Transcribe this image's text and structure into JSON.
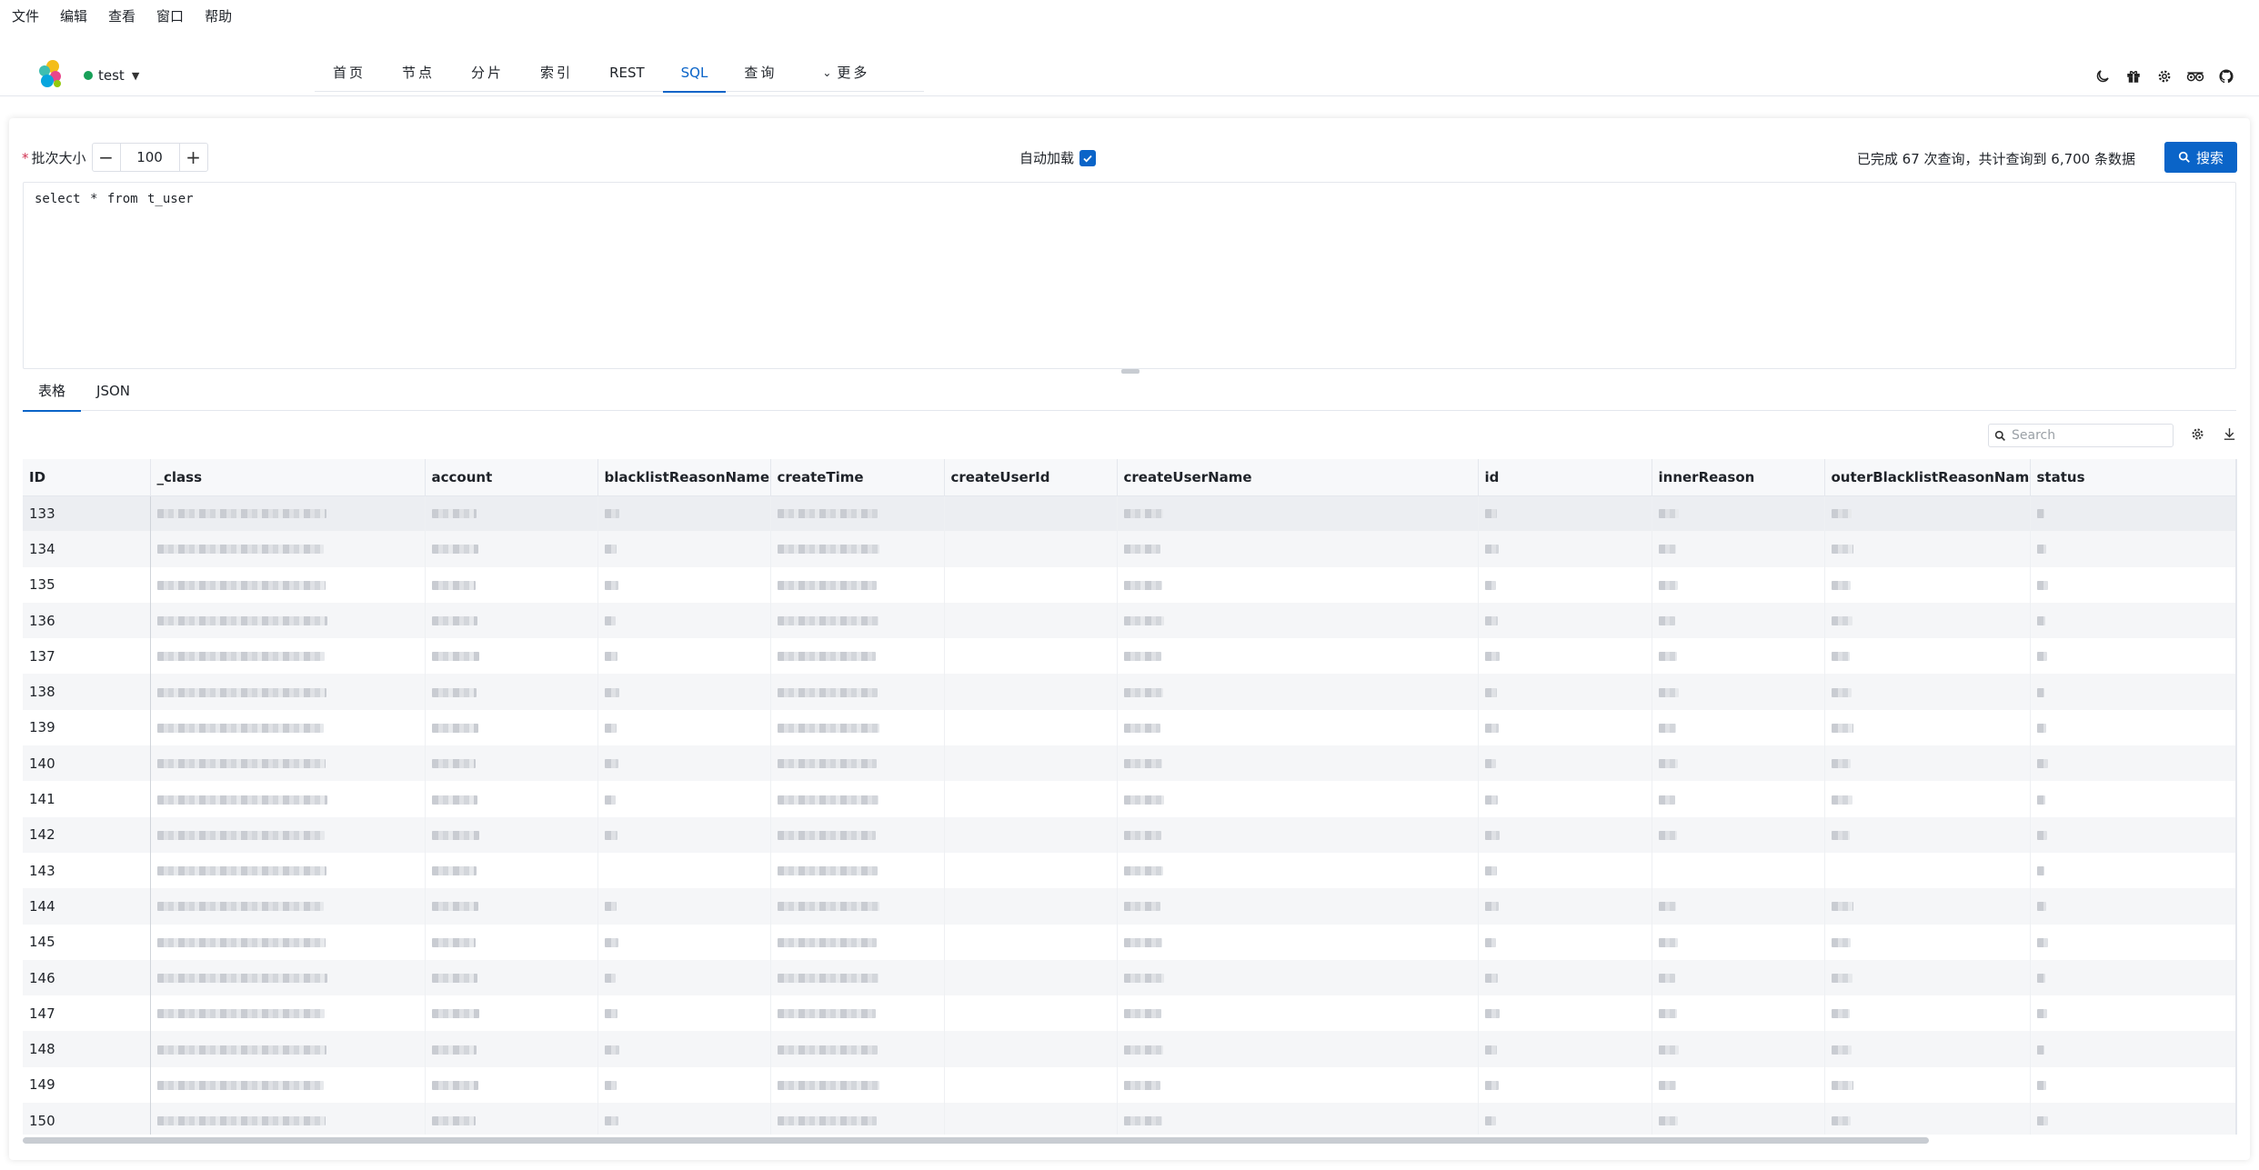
{
  "menubar": [
    "文件",
    "编辑",
    "查看",
    "窗口",
    "帮助"
  ],
  "cluster": {
    "name": "test",
    "status_color": "#18a058"
  },
  "nav": [
    {
      "label": "首页",
      "active": false
    },
    {
      "label": "节点",
      "active": false
    },
    {
      "label": "分片",
      "active": false
    },
    {
      "label": "索引",
      "active": false
    },
    {
      "label": "REST",
      "active": false
    },
    {
      "label": "SQL",
      "active": true
    },
    {
      "label": "查询",
      "active": false
    },
    {
      "label": "更多",
      "active": false
    }
  ],
  "header_icons": [
    "moon-icon",
    "gift-icon",
    "settings-icon",
    "tripadvisor-icon",
    "github-icon"
  ],
  "toolbar": {
    "batch_label": "批次大小",
    "batch_value": "100",
    "autoload_label": "自动加载",
    "autoload_checked": true,
    "status": "已完成 67 次查询，共计查询到 6,700 条数据",
    "search_label": "搜索"
  },
  "editor": {
    "sql": "select * from t_user"
  },
  "result_tabs": [
    {
      "label": "表格",
      "active": true
    },
    {
      "label": "JSON",
      "active": false
    }
  ],
  "table_search": {
    "placeholder": "Search"
  },
  "table": {
    "columns": [
      "ID",
      "_class",
      "account",
      "blacklistReasonName",
      "createTime",
      "createUserId",
      "createUserName",
      "id",
      "innerReason",
      "outerBlacklistReasonName",
      "status"
    ],
    "ids": [
      "133",
      "134",
      "135",
      "136",
      "137",
      "138",
      "139",
      "140",
      "141",
      "142",
      "143",
      "144",
      "145",
      "146",
      "147",
      "148",
      "149",
      "150"
    ]
  },
  "colors": {
    "accent": "#0a64c8",
    "border": "#e4e7ed"
  }
}
